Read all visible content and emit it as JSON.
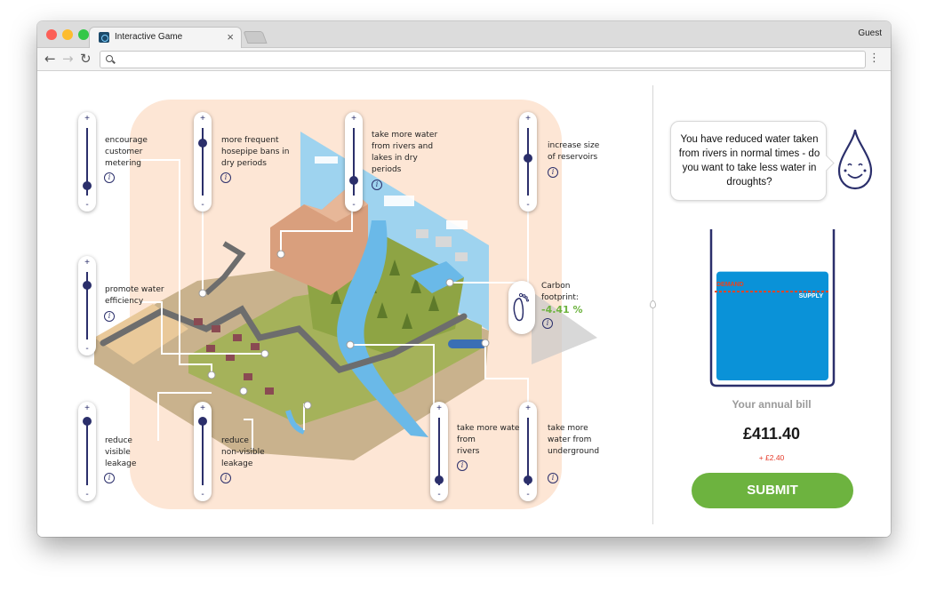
{
  "browser": {
    "tab_title": "Interactive Game",
    "tab_close": "×",
    "profile_label": "Guest",
    "address": "",
    "nav": {
      "back": "←",
      "forward": "→",
      "reload": "↻",
      "menu": "⋮"
    },
    "traffic_lights": [
      "#fc5f57",
      "#fdbc2e",
      "#33c748"
    ]
  },
  "levers": [
    {
      "id": "metering",
      "label": "encourage\ncustomer\nmetering",
      "level": 0.15
    },
    {
      "id": "hosepipe",
      "label": "more frequent\nhosepipe bans in\ndry periods",
      "level": 0.78
    },
    {
      "id": "drought-abstraction",
      "label": "take more water\nfrom rivers and\nlakes in dry\nperiods",
      "level": 0.22
    },
    {
      "id": "reservoirs",
      "label": "increase size\nof reservoirs",
      "level": 0.55
    },
    {
      "id": "efficiency",
      "label": "promote water\nefficiency",
      "level": 0.8
    },
    {
      "id": "visible-leakage",
      "label": "reduce\nvisible\nleakage",
      "level": 0.95
    },
    {
      "id": "nonvisible-leakage",
      "label": "reduce\nnon-visible\nleakage",
      "level": 0.95
    },
    {
      "id": "rivers",
      "label": "take more water\nfrom\nrivers",
      "level": 0.08
    },
    {
      "id": "underground",
      "label": "take more\nwater from\nunderground",
      "level": 0.08
    }
  ],
  "slider_glyphs": {
    "plus": "+",
    "minus": "-",
    "info": "i"
  },
  "carbon": {
    "label": "Carbon\nfootprint:",
    "value": "-4.41 %"
  },
  "message": "You have reduced water taken from rivers in normal times - do you want to take less water in droughts?",
  "glass": {
    "demand_label": "DEMAND",
    "supply_label": "SUPPLY",
    "demand_color": "#e8431f",
    "supply_color": "#0a92d8",
    "supply_level": 0.72,
    "demand_level": 0.67
  },
  "bill": {
    "label": "Your annual bill",
    "amount": "£411.40",
    "change": "+ £2.40"
  },
  "submit_label": "SUBMIT",
  "colors": {
    "accent_green": "#6db33f",
    "lever_navy": "#2b2f6b",
    "scene_peach": "#fde6d5"
  }
}
